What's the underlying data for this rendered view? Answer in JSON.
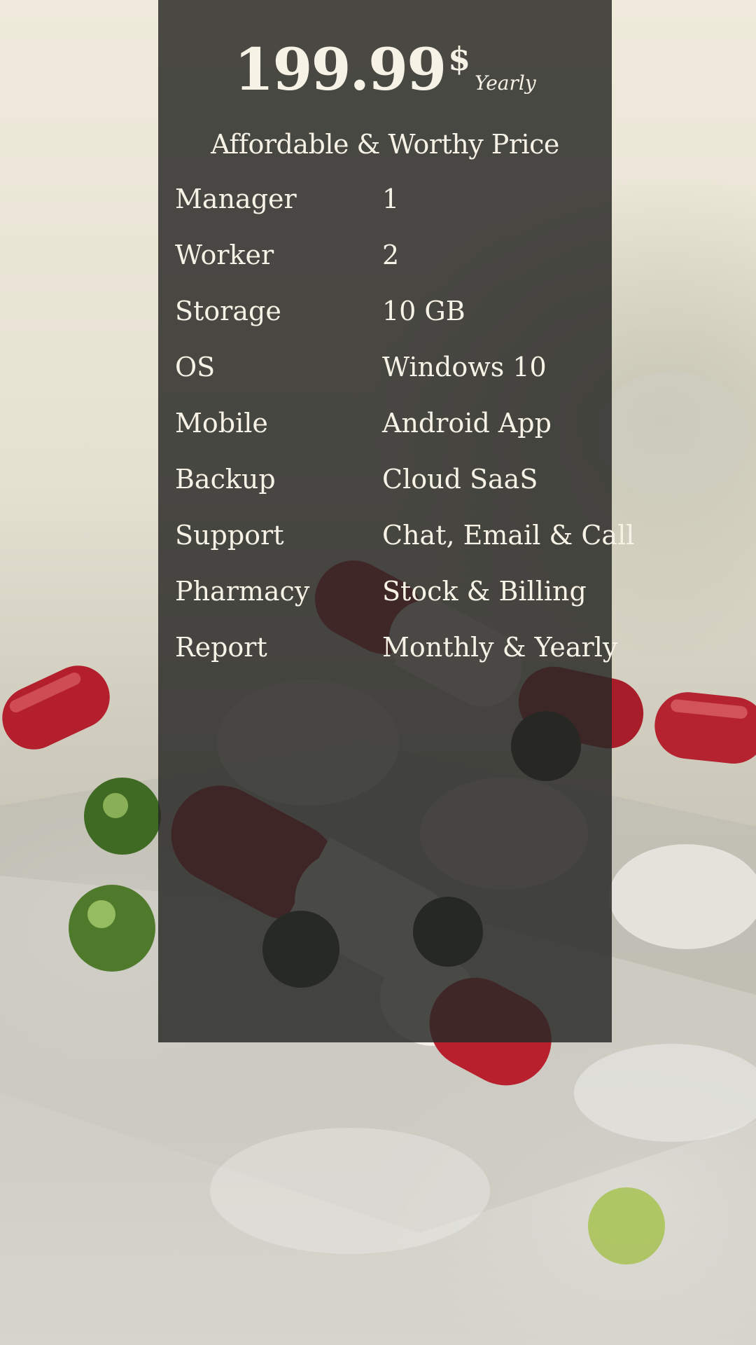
{
  "pricing": {
    "amount": "199.99",
    "currency": "$",
    "period": "Yearly",
    "subtitle": "Affordable & Worthy Price"
  },
  "features": [
    {
      "label": "Manager",
      "value": "1"
    },
    {
      "label": "Worker",
      "value": "2"
    },
    {
      "label": "Storage",
      "value": "10 GB"
    },
    {
      "label": "OS",
      "value": "Windows 10"
    },
    {
      "label": "Mobile",
      "value": "Android App"
    },
    {
      "label": "Backup",
      "value": "Cloud SaaS"
    },
    {
      "label": "Support",
      "value": "Chat, Email & Call"
    },
    {
      "label": "Pharmacy",
      "value": "Stock & Billing"
    },
    {
      "label": "Report",
      "value": "Monthly & Yearly"
    }
  ],
  "colors": {
    "card": "#282826",
    "text": "#f6f2e6",
    "capsule_red": "#b3202e",
    "capsule_white": "#f1ede3",
    "pill_green": "#4f7a2b"
  },
  "background_image": "capsules-and-blister-pack-photo"
}
